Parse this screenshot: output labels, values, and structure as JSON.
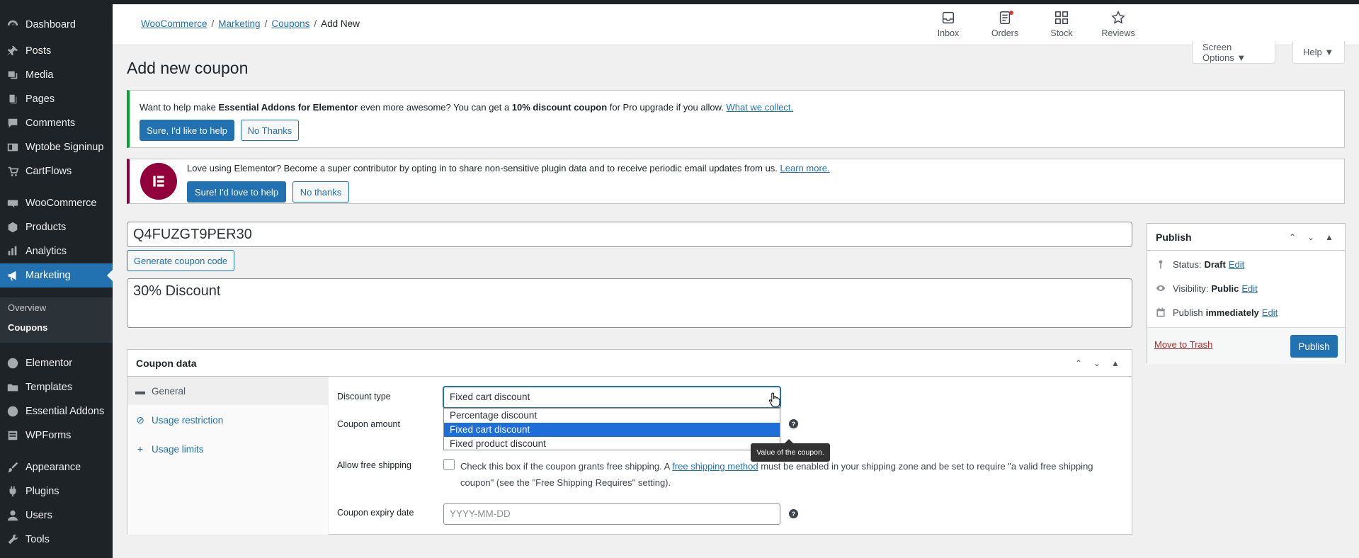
{
  "sidebar": {
    "items": [
      {
        "label": "Dashboard",
        "icon": "dashboard-icon"
      },
      {
        "label": "Posts",
        "icon": "pin-icon"
      },
      {
        "label": "Media",
        "icon": "media-icon"
      },
      {
        "label": "Pages",
        "icon": "pages-icon"
      },
      {
        "label": "Comments",
        "icon": "comments-icon"
      },
      {
        "label": "Wptobe Signinup",
        "icon": "signup-icon"
      },
      {
        "label": "CartFlows",
        "icon": "cartflows-icon"
      },
      {
        "label": "WooCommerce",
        "icon": "woocommerce-icon"
      },
      {
        "label": "Products",
        "icon": "products-icon"
      },
      {
        "label": "Analytics",
        "icon": "analytics-icon"
      },
      {
        "label": "Marketing",
        "icon": "megaphone-icon"
      },
      {
        "label": "Elementor",
        "icon": "elementor-icon"
      },
      {
        "label": "Templates",
        "icon": "folder-icon"
      },
      {
        "label": "Essential Addons",
        "icon": "addons-icon"
      },
      {
        "label": "WPForms",
        "icon": "forms-icon"
      },
      {
        "label": "Appearance",
        "icon": "brush-icon"
      },
      {
        "label": "Plugins",
        "icon": "plugin-icon"
      },
      {
        "label": "Users",
        "icon": "user-icon"
      },
      {
        "label": "Tools",
        "icon": "wrench-icon"
      }
    ],
    "submenu": [
      "Overview",
      "Coupons"
    ],
    "active": "Marketing"
  },
  "breadcrumb": {
    "items": [
      "WooCommerce",
      "Marketing",
      "Coupons"
    ],
    "separator": "/",
    "current": "Add New"
  },
  "header_buttons": [
    {
      "label": "Inbox",
      "icon": "inbox-icon"
    },
    {
      "label": "Orders",
      "icon": "orders-icon"
    },
    {
      "label": "Stock",
      "icon": "stock-icon"
    },
    {
      "label": "Reviews",
      "icon": "star-icon"
    }
  ],
  "screen_options": "Screen Options ▼",
  "help": "Help ▼",
  "page_title": "Add new coupon",
  "notice1": {
    "text_a": "Want to help make ",
    "text_b": "Essential Addons for Elementor",
    "text_c": " even more awesome? You can get a ",
    "text_d": "10% discount coupon",
    "text_e": " for Pro upgrade if you allow. ",
    "link": "What we collect.",
    "primary": "Sure, I'd like to help",
    "secondary": "No Thanks"
  },
  "notice2": {
    "text": "Love using Elementor? Become a super contributor by opting in to share non-sensitive plugin data and to receive periodic email updates from us. ",
    "link": "Learn more.",
    "primary": "Sure! I'd love to help",
    "secondary": "No thanks"
  },
  "coupon_code": "Q4FUZGT9PER30",
  "generate_button": "Generate coupon code",
  "description": "30% Discount",
  "coupon_data": {
    "title": "Coupon data",
    "tabs": [
      {
        "label": "General",
        "icon": "ticket-icon"
      },
      {
        "label": "Usage restriction",
        "icon": "restriction-icon"
      },
      {
        "label": "Usage limits",
        "icon": "plus-icon"
      }
    ],
    "discount_type_label": "Discount type",
    "discount_type_value": "Fixed cart discount",
    "discount_options": [
      "Percentage discount",
      "Fixed cart discount",
      "Fixed product discount"
    ],
    "coupon_amount_label": "Coupon amount",
    "tooltip": "Value of the coupon.",
    "free_shipping_label": "Allow free shipping",
    "free_shipping_text_a": "Check this box if the coupon grants free shipping. A ",
    "free_shipping_link": "free shipping method",
    "free_shipping_text_b": " must be enabled in your shipping zone and be set to require \"a valid free shipping coupon\" (see the \"Free Shipping Requires\" setting).",
    "expiry_label": "Coupon expiry date",
    "expiry_placeholder": "YYYY-MM-DD"
  },
  "publish": {
    "title": "Publish",
    "status_label": "Status:",
    "status_value": "Draft",
    "visibility_label": "Visibility:",
    "visibility_value": "Public",
    "publish_label": "Publish",
    "publish_value": "immediately",
    "edit": "Edit",
    "trash": "Move to Trash",
    "button": "Publish"
  },
  "colors": {
    "accent": "#2271b1",
    "sidebar": "#1d2327",
    "elementor": "#92003b",
    "success": "#00a32a"
  }
}
